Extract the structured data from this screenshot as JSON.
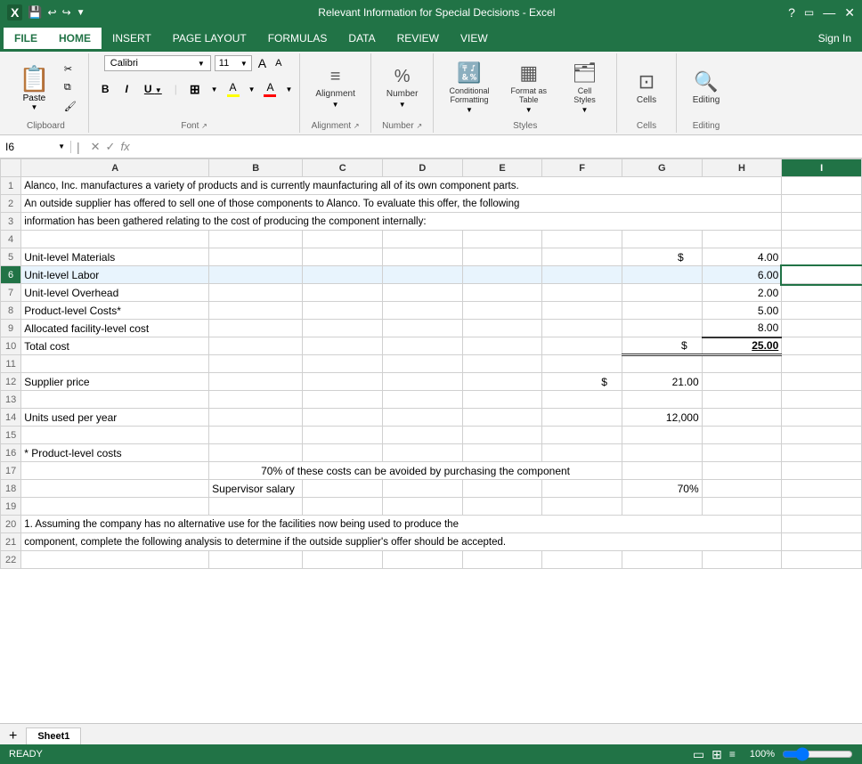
{
  "titleBar": {
    "title": "Relevant Information for Special Decisions - Excel",
    "icons": [
      "save-icon",
      "undo-icon",
      "redo-icon",
      "customize-icon"
    ],
    "windowControls": [
      "help-icon",
      "restore-icon",
      "minimize-icon",
      "close-icon"
    ]
  },
  "ribbon": {
    "tabs": [
      "FILE",
      "HOME",
      "INSERT",
      "PAGE LAYOUT",
      "FORMULAS",
      "DATA",
      "REVIEW",
      "VIEW"
    ],
    "activeTab": "HOME",
    "signIn": "Sign In",
    "groups": {
      "clipboard": {
        "label": "Clipboard",
        "paste": "Paste",
        "cut": "✂",
        "copy": "⧉",
        "formatPainter": "🖌"
      },
      "font": {
        "label": "Font",
        "fontName": "Calibri",
        "fontSize": "11",
        "bold": "B",
        "italic": "I",
        "underline": "U",
        "highlightColor": "yellow",
        "fontColor": "red"
      },
      "alignment": {
        "label": "Alignment",
        "name": "Alignment"
      },
      "number": {
        "label": "Number",
        "name": "Number"
      },
      "conditionalFormatting": {
        "label": "Conditional Formatting",
        "name": "Conditional Formatting"
      },
      "formatAsTable": {
        "label": "Format as Table",
        "name": "Format as\nTable"
      },
      "cellStyles": {
        "label": "Cell Styles",
        "name": "Cell Styles"
      },
      "cells": {
        "label": "Cells",
        "name": "Cells"
      },
      "editing": {
        "label": "Editing",
        "name": "Editing"
      }
    }
  },
  "formulaBar": {
    "cellRef": "I6",
    "formula": ""
  },
  "columns": [
    "A",
    "B",
    "C",
    "D",
    "E",
    "F",
    "G",
    "H",
    "I"
  ],
  "rows": [
    {
      "rowNum": 1,
      "cells": [
        {
          "col": "A",
          "value": "Alanco, Inc. manufactures a variety of products and is currently maunfacturing all of its own component parts.",
          "colspan": 8,
          "style": ""
        }
      ]
    },
    {
      "rowNum": 2,
      "cells": [
        {
          "col": "A",
          "value": "An outside supplier has offered to sell one of those components to Alanco.  To evaluate this offer, the following",
          "colspan": 8,
          "style": ""
        }
      ]
    },
    {
      "rowNum": 3,
      "cells": [
        {
          "col": "A",
          "value": "information has been gathered relating to the cost of producing the component internally:",
          "colspan": 8,
          "style": ""
        }
      ]
    },
    {
      "rowNum": 4,
      "cells": []
    },
    {
      "rowNum": 5,
      "cells": [
        {
          "col": "A",
          "value": "Unit-level Materials",
          "style": ""
        },
        {
          "col": "G",
          "value": "$",
          "style": "cell-right dollar-sign"
        },
        {
          "col": "H",
          "value": "4.00",
          "style": "cell-right"
        }
      ]
    },
    {
      "rowNum": 6,
      "cells": [
        {
          "col": "A",
          "value": "Unit-level Labor",
          "style": ""
        },
        {
          "col": "H",
          "value": "6.00",
          "style": "cell-right"
        }
      ]
    },
    {
      "rowNum": 7,
      "cells": [
        {
          "col": "A",
          "value": "Unit-level Overhead",
          "style": ""
        },
        {
          "col": "H",
          "value": "2.00",
          "style": "cell-right"
        }
      ]
    },
    {
      "rowNum": 8,
      "cells": [
        {
          "col": "A",
          "value": "Product-level  Costs*",
          "style": ""
        },
        {
          "col": "H",
          "value": "5.00",
          "style": "cell-right"
        }
      ]
    },
    {
      "rowNum": 9,
      "cells": [
        {
          "col": "A",
          "value": "Allocated facility-level cost",
          "style": ""
        },
        {
          "col": "H",
          "value": "8.00",
          "style": "cell-right cell-underline"
        }
      ]
    },
    {
      "rowNum": 10,
      "cells": [
        {
          "col": "A",
          "value": "Total cost",
          "style": ""
        },
        {
          "col": "G",
          "value": "$",
          "style": "cell-right dollar-sign cell-underline"
        },
        {
          "col": "H",
          "value": "25.00",
          "style": "cell-right cell-underline cell-bold"
        }
      ]
    },
    {
      "rowNum": 11,
      "cells": []
    },
    {
      "rowNum": 12,
      "cells": [
        {
          "col": "A",
          "value": "Supplier price",
          "style": ""
        },
        {
          "col": "F",
          "value": "$",
          "style": "cell-right"
        },
        {
          "col": "G",
          "value": "21.00",
          "style": "cell-right"
        }
      ]
    },
    {
      "rowNum": 13,
      "cells": []
    },
    {
      "rowNum": 14,
      "cells": [
        {
          "col": "A",
          "value": "Units used per year",
          "style": ""
        },
        {
          "col": "G",
          "value": "12,000",
          "style": "cell-right"
        }
      ]
    },
    {
      "rowNum": 15,
      "cells": []
    },
    {
      "rowNum": 16,
      "cells": [
        {
          "col": "A",
          "value": "* Product-level costs",
          "style": ""
        }
      ]
    },
    {
      "rowNum": 17,
      "cells": [
        {
          "col": "B",
          "value": "70% of these costs can be avoided by purchasing the component",
          "colspan": 5,
          "style": ""
        }
      ]
    },
    {
      "rowNum": 18,
      "cells": [
        {
          "col": "B",
          "value": "Supervisor salary",
          "style": ""
        },
        {
          "col": "G",
          "value": "70%",
          "style": "cell-right"
        }
      ]
    },
    {
      "rowNum": 19,
      "cells": []
    },
    {
      "rowNum": 20,
      "cells": [
        {
          "col": "A",
          "value": "1. Assuming the company has no alternative use for the facilities now being used to produce the",
          "colspan": 8,
          "style": ""
        }
      ]
    },
    {
      "rowNum": 21,
      "cells": [
        {
          "col": "A",
          "value": "component, complete the following analysis to determine if the outside supplier's offer should be accepted.",
          "colspan": 8,
          "style": ""
        }
      ]
    },
    {
      "rowNum": 22,
      "cells": []
    }
  ],
  "sheetTabs": [
    "Sheet1"
  ],
  "statusBar": {
    "ready": "READY",
    "viewButtons": [
      "normal-view",
      "page-layout-view",
      "page-break-view"
    ],
    "zoom": "100%"
  }
}
